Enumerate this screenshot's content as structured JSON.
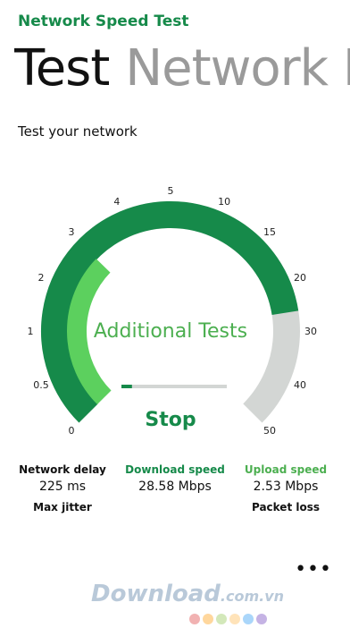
{
  "app": {
    "title": "Network Speed Test"
  },
  "pivot": {
    "items": [
      "Test",
      "Network H"
    ],
    "active_index": 0
  },
  "section": {
    "title": "Test your network"
  },
  "gauge": {
    "tick_labels": [
      "0",
      "0.5",
      "1",
      "2",
      "3",
      "4",
      "5",
      "10",
      "15",
      "20",
      "30",
      "40",
      "50"
    ],
    "center_label": "Additional Tests",
    "stop_label": "Stop",
    "progress_fraction": 0.1,
    "outer_progress_fraction": 0.8,
    "inner_progress_fraction": 0.33
  },
  "stats": {
    "delay_label": "Network delay",
    "delay_value": "225 ms",
    "jitter_label": "Max jitter",
    "download_label": "Download speed",
    "download_value": "28.58 Mbps",
    "upload_label": "Upload speed",
    "upload_value": "2.53 Mbps",
    "packet_label": "Packet loss"
  },
  "more": {
    "label": "•••"
  },
  "watermark": {
    "text": "Download",
    "domain": ".com.vn"
  },
  "colors": {
    "accent_dark": "#168a4a",
    "accent_light": "#5cd05e",
    "track": "#d3d6d4",
    "download_green": "#168a4a",
    "upload_green": "#4caf50"
  }
}
